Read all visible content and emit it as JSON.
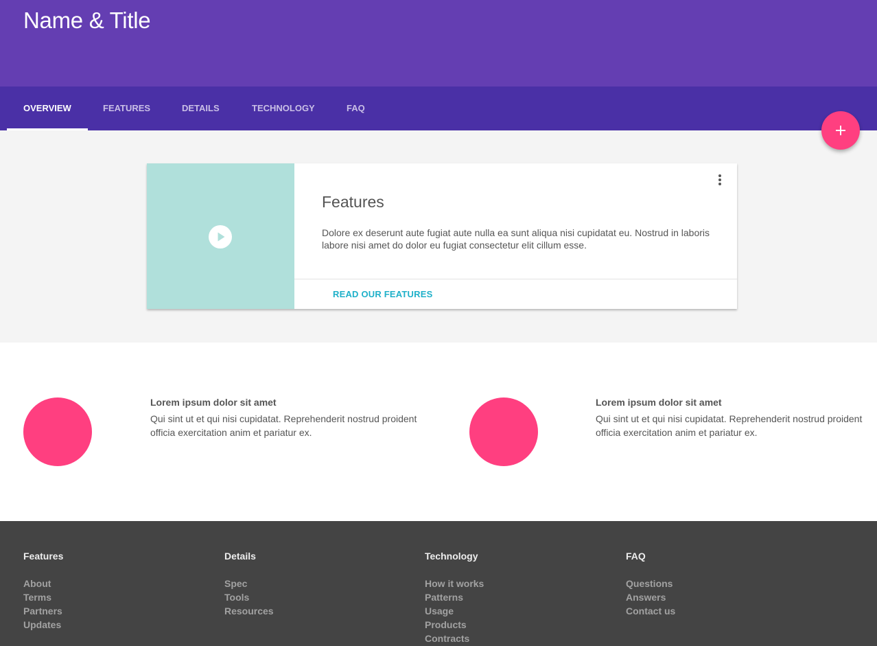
{
  "header": {
    "title": "Name & Title"
  },
  "tabs": [
    {
      "label": "Overview"
    },
    {
      "label": "Features"
    },
    {
      "label": "Details"
    },
    {
      "label": "Technology"
    },
    {
      "label": "FAQ"
    }
  ],
  "fab": {
    "icon": "plus-icon"
  },
  "card": {
    "heading": "Features",
    "body": "Dolore ex deserunt aute fugiat aute nulla ea sunt aliqua nisi cupidatat eu. Nostrud in laboris labore nisi amet do dolor eu fugiat consectetur elit cillum esse.",
    "action_label": "READ OUR FEATURES",
    "media_icon": "play-icon",
    "menu_icon": "more-vert-icon"
  },
  "features": [
    {
      "title": "Lorem ipsum dolor sit amet",
      "text": "Qui sint ut et qui nisi cupidatat. Reprehenderit nostrud proident officia exercitation anim et pariatur ex."
    },
    {
      "title": "Lorem ipsum dolor sit amet",
      "text": "Qui sint ut et qui nisi cupidatat. Reprehenderit nostrud proident officia exercitation anim et pariatur ex."
    }
  ],
  "footer": {
    "columns": [
      {
        "heading": "Features",
        "links": [
          "About",
          "Terms",
          "Partners",
          "Updates"
        ]
      },
      {
        "heading": "Details",
        "links": [
          "Spec",
          "Tools",
          "Resources"
        ]
      },
      {
        "heading": "Technology",
        "links": [
          "How it works",
          "Patterns",
          "Usage",
          "Products",
          "Contracts"
        ]
      },
      {
        "heading": "FAQ",
        "links": [
          "Questions",
          "Answers",
          "Contact us"
        ]
      }
    ]
  },
  "colors": {
    "header": "#643eb2",
    "tabs": "#4a30a6",
    "accent": "#ff3f80",
    "media": "#b0e0db",
    "link": "#1fb0c9",
    "footer": "#444444"
  }
}
